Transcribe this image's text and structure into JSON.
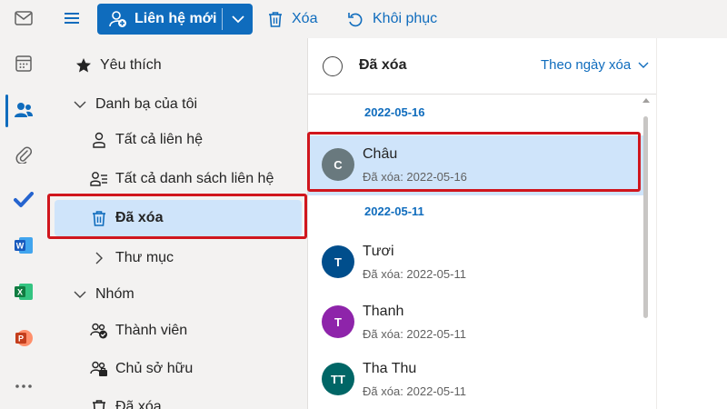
{
  "toolbar": {
    "new_contact_label": "Liên hệ mới",
    "delete_label": "Xóa",
    "restore_label": "Khôi phục"
  },
  "folders": {
    "favorites": "Yêu thích",
    "my_contacts": "Danh bạ của tôi",
    "all_contacts": "Tất cả liên hệ",
    "all_contact_lists": "Tất cả danh sách liên hệ",
    "deleted": "Đã xóa",
    "folder": "Thư mục",
    "groups": "Nhóm",
    "members": "Thành viên",
    "owners": "Chủ sở hữu",
    "groups_deleted": "Đã xóa"
  },
  "list": {
    "title": "Đã xóa",
    "sort_label": "Theo ngày xóa",
    "groups": [
      {
        "date": "2022-05-16",
        "contacts": [
          {
            "initials": "C",
            "name": "Châu",
            "sub": "Đã xóa: 2022-05-16",
            "color": "#69797e",
            "selected": true
          }
        ]
      },
      {
        "date": "2022-05-11",
        "contacts": [
          {
            "initials": "T",
            "name": "Tươi",
            "sub": "Đã xóa: 2022-05-11",
            "color": "#004e8c",
            "selected": false
          },
          {
            "initials": "T",
            "name": "Thanh",
            "sub": "Đã xóa: 2022-05-11",
            "color": "#8e24aa",
            "selected": false
          },
          {
            "initials": "TT",
            "name": "Tha Thu",
            "sub": "Đã xóa: 2022-05-11",
            "color": "#006666",
            "selected": false
          }
        ]
      }
    ]
  },
  "colors": {
    "accent": "#0f6cbd",
    "selection": "#cfe4fa",
    "highlight_box": "#d0161d"
  }
}
